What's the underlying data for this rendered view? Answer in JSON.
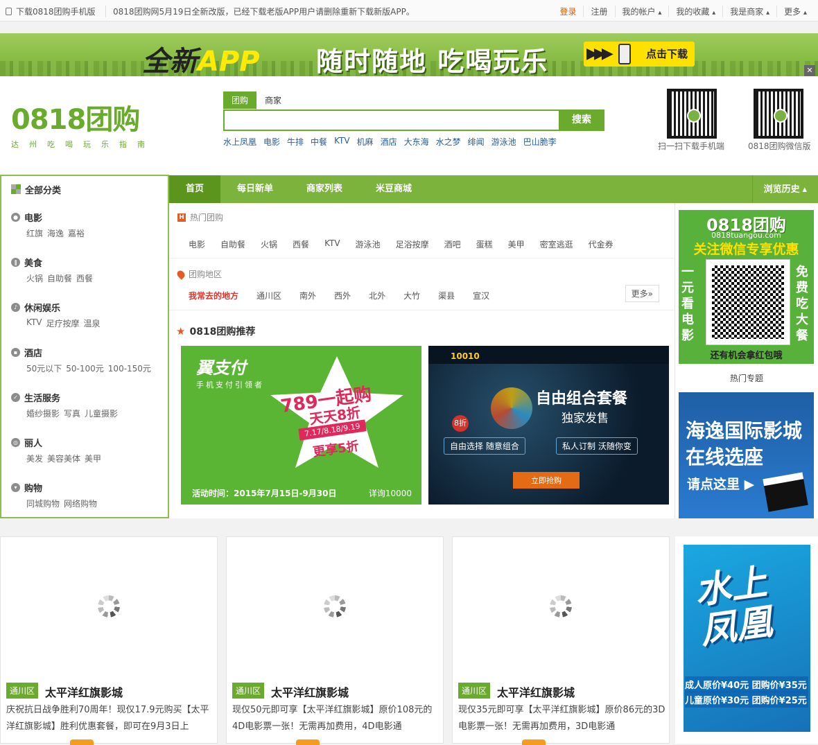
{
  "topbar": {
    "app_link": "下载0818团购手机版",
    "notice": "0818团购网5月19日全新改版，已经下载老版APP用户请删除重新下载新版APP。",
    "login": "登录",
    "register": "注册",
    "my_account": "我的帐户",
    "my_favorites": "我的收藏",
    "i_am_merchant": "我是商家",
    "more": "更多"
  },
  "banner": {
    "new_prefix": "全新",
    "app_word": "APP",
    "slogan": "随时随地 吃喝玩乐",
    "download": "点击下载"
  },
  "logo": {
    "main": "0818团购",
    "subtitle": "达州吃喝玩乐指南"
  },
  "search": {
    "tabs": [
      "团购",
      "商家"
    ],
    "placeholder": "",
    "button": "搜索",
    "hot_words": [
      "水上凤凰",
      "电影",
      "牛排",
      "中餐",
      "KTV",
      "机麻",
      "酒店",
      "大东海",
      "水之梦",
      "绯闻",
      "游泳池",
      "巴山脆李"
    ]
  },
  "qrcodes": [
    {
      "caption": "扫一扫下载手机端"
    },
    {
      "caption": "0818团购微信版"
    }
  ],
  "categories": {
    "title": "全部分类",
    "items": [
      {
        "name": "电影",
        "icon": "film-icon",
        "subs": [
          "红旗",
          "海逸",
          "嘉裕"
        ]
      },
      {
        "name": "美食",
        "icon": "food-icon",
        "subs": [
          "火锅",
          "自助餐",
          "西餐"
        ]
      },
      {
        "name": "休闲娱乐",
        "icon": "leisure-icon",
        "subs": [
          "KTV",
          "足疗按摩",
          "温泉"
        ]
      },
      {
        "name": "酒店",
        "icon": "hotel-icon",
        "subs": [
          "50元以下",
          "50-100元",
          "100-150元"
        ]
      },
      {
        "name": "生活服务",
        "icon": "life-service-icon",
        "subs": [
          "婚纱摄影",
          "写真",
          "儿童摄影"
        ]
      },
      {
        "name": "丽人",
        "icon": "beauty-icon",
        "subs": [
          "美发",
          "美容美体",
          "美甲"
        ]
      },
      {
        "name": "购物",
        "icon": "shopping-icon",
        "subs": [
          "同城购物",
          "网络购物"
        ]
      }
    ]
  },
  "nav": {
    "tabs": [
      "首页",
      "每日新单",
      "商家列表",
      "米豆商城"
    ],
    "history": "浏览历史"
  },
  "hot_deals": {
    "title": "热门团购",
    "items": [
      "电影",
      "自助餐",
      "火锅",
      "西餐",
      "KTV",
      "游泳池",
      "足浴按摩",
      "酒吧",
      "蛋糕",
      "美甲",
      "密室逃逛",
      "代金券"
    ]
  },
  "areas": {
    "title": "团购地区",
    "items": [
      "我常去的地方",
      "通川区",
      "南外",
      "西外",
      "北外",
      "大竹",
      "渠县",
      "宣汉"
    ],
    "more": "更多»"
  },
  "recommend": {
    "title": "0818团购推荐",
    "ad1": {
      "brand": "翼支付",
      "slogan": "手机支付引领者",
      "headline": "789一起购",
      "discount": "天天8折",
      "dates": "7.17/8.18/9.19",
      "extra": "更享5折",
      "period": "活动时间：2015年7月15日-9月30日",
      "hotline": "详询10000"
    },
    "ad2": {
      "brand": "10010",
      "headline": "自由组合套餐",
      "sub": "独家发售",
      "discount": "8折",
      "pill1": "自由选择 随意组合",
      "pill2": "私人订制 沃随你变",
      "buy": "立即抢购"
    }
  },
  "side": {
    "wechat": {
      "logo": "0818团购",
      "domain": "0818tuangou.com",
      "headline": "关注微信专享优惠",
      "left": "一元看电影",
      "right": "免费吃大餐",
      "bottom": "还有机会拿红包哦"
    },
    "topic_title": "热门专题",
    "cinema": {
      "line1": "海逸国际影城",
      "line2": "在线选座",
      "line3": "请点这里"
    }
  },
  "deals": [
    {
      "area": "通川区",
      "name": "太平洋红旗影城",
      "desc": "庆祝抗日战争胜利70周年！现仅17.9元购买【太平洋红旗影城】胜利优惠套餐，即可在9月3日上"
    },
    {
      "area": "通川区",
      "name": "太平洋红旗影城",
      "desc": "现仅50元即可享【太平洋红旗影城】原价108元的4D电影票一张！无需再加费用，4D电影通"
    },
    {
      "area": "通川区",
      "name": "太平洋红旗影城",
      "desc": "现仅35元即可享【太平洋红旗影城】原价86元的3D电影票一张！无需再加费用，3D电影通"
    }
  ],
  "side_ad": {
    "title": "水上凤凰",
    "price1": "成人原价¥40元 团购价¥35元",
    "price2": "儿童原价¥30元 团购价¥25元"
  }
}
